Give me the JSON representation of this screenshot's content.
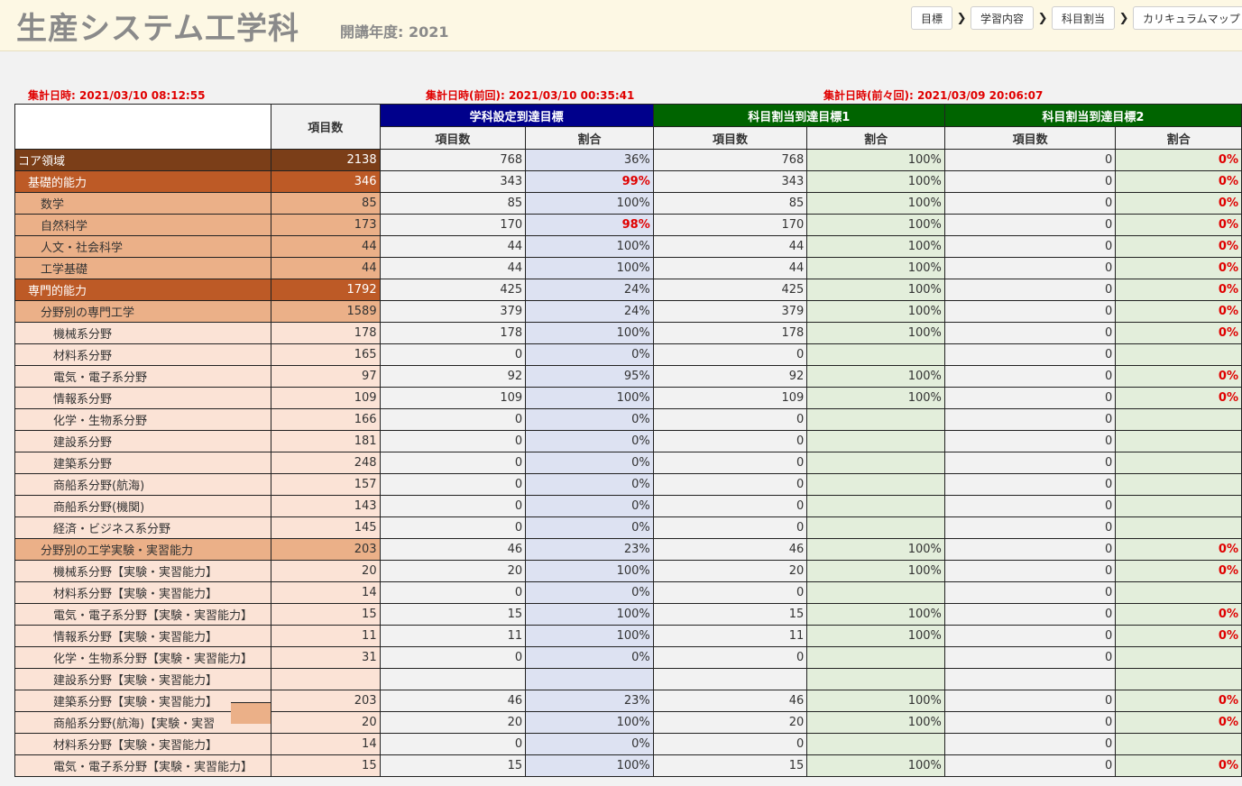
{
  "header": {
    "title": "生産システム工学科",
    "year_label": "開講年度: 2021",
    "nav": [
      {
        "label": "目標"
      },
      {
        "label": "学習内容"
      },
      {
        "label": "科目割当"
      },
      {
        "label": "カリキュラムマップ"
      }
    ]
  },
  "timestamps": {
    "current": "集計日時: 2021/03/10 08:12:55",
    "previous": "集計日時(前回): 2021/03/10 00:35:41",
    "before_previous": "集計日時(前々回): 2021/03/09 20:06:07"
  },
  "table": {
    "header": {
      "count": "項目数",
      "group1": "学科設定到達目標",
      "group2": "科目割当到達目標1",
      "group3": "科目割当到達目標2",
      "sub_count": "項目数",
      "sub_ratio": "割合"
    },
    "rows": [
      {
        "name": "コア領域",
        "level": 0,
        "total": "2138",
        "c1": "768",
        "r1": "36%",
        "r1red": false,
        "c2": "768",
        "r2": "100%",
        "r2red": false,
        "c3": "0",
        "r3": "0%",
        "r3red": true
      },
      {
        "name": "基礎的能力",
        "level": 1,
        "total": "346",
        "c1": "343",
        "r1": "99%",
        "r1red": true,
        "c2": "343",
        "r2": "100%",
        "r2red": false,
        "c3": "0",
        "r3": "0%",
        "r3red": true
      },
      {
        "name": "数学",
        "level": 2,
        "total": "85",
        "c1": "85",
        "r1": "100%",
        "r1red": false,
        "c2": "85",
        "r2": "100%",
        "r2red": false,
        "c3": "0",
        "r3": "0%",
        "r3red": true
      },
      {
        "name": "自然科学",
        "level": 2,
        "total": "173",
        "c1": "170",
        "r1": "98%",
        "r1red": true,
        "c2": "170",
        "r2": "100%",
        "r2red": false,
        "c3": "0",
        "r3": "0%",
        "r3red": true
      },
      {
        "name": "人文・社会科学",
        "level": 2,
        "total": "44",
        "c1": "44",
        "r1": "100%",
        "r1red": false,
        "c2": "44",
        "r2": "100%",
        "r2red": false,
        "c3": "0",
        "r3": "0%",
        "r3red": true
      },
      {
        "name": "工学基礎",
        "level": 2,
        "total": "44",
        "c1": "44",
        "r1": "100%",
        "r1red": false,
        "c2": "44",
        "r2": "100%",
        "r2red": false,
        "c3": "0",
        "r3": "0%",
        "r3red": true
      },
      {
        "name": "専門的能力",
        "level": 1,
        "total": "1792",
        "c1": "425",
        "r1": "24%",
        "r1red": false,
        "c2": "425",
        "r2": "100%",
        "r2red": false,
        "c3": "0",
        "r3": "0%",
        "r3red": true
      },
      {
        "name": "分野別の専門工学",
        "level": 2,
        "total": "1589",
        "c1": "379",
        "r1": "24%",
        "r1red": false,
        "c2": "379",
        "r2": "100%",
        "r2red": false,
        "c3": "0",
        "r3": "0%",
        "r3red": true
      },
      {
        "name": "機械系分野",
        "level": 3,
        "total": "178",
        "c1": "178",
        "r1": "100%",
        "r1red": false,
        "c2": "178",
        "r2": "100%",
        "r2red": false,
        "c3": "0",
        "r3": "0%",
        "r3red": true
      },
      {
        "name": "材料系分野",
        "level": 3,
        "total": "165",
        "c1": "0",
        "r1": "0%",
        "r1red": false,
        "c2": "0",
        "r2": "",
        "r2red": false,
        "c3": "0",
        "r3": "",
        "r3red": false
      },
      {
        "name": "電気・電子系分野",
        "level": 3,
        "total": "97",
        "c1": "92",
        "r1": "95%",
        "r1red": false,
        "c2": "92",
        "r2": "100%",
        "r2red": false,
        "c3": "0",
        "r3": "0%",
        "r3red": true
      },
      {
        "name": "情報系分野",
        "level": 3,
        "total": "109",
        "c1": "109",
        "r1": "100%",
        "r1red": false,
        "c2": "109",
        "r2": "100%",
        "r2red": false,
        "c3": "0",
        "r3": "0%",
        "r3red": true
      },
      {
        "name": "化学・生物系分野",
        "level": 3,
        "total": "166",
        "c1": "0",
        "r1": "0%",
        "r1red": false,
        "c2": "0",
        "r2": "",
        "r2red": false,
        "c3": "0",
        "r3": "",
        "r3red": false
      },
      {
        "name": "建設系分野",
        "level": 3,
        "total": "181",
        "c1": "0",
        "r1": "0%",
        "r1red": false,
        "c2": "0",
        "r2": "",
        "r2red": false,
        "c3": "0",
        "r3": "",
        "r3red": false
      },
      {
        "name": "建築系分野",
        "level": 3,
        "total": "248",
        "c1": "0",
        "r1": "0%",
        "r1red": false,
        "c2": "0",
        "r2": "",
        "r2red": false,
        "c3": "0",
        "r3": "",
        "r3red": false
      },
      {
        "name": "商船系分野(航海)",
        "level": 3,
        "total": "157",
        "c1": "0",
        "r1": "0%",
        "r1red": false,
        "c2": "0",
        "r2": "",
        "r2red": false,
        "c3": "0",
        "r3": "",
        "r3red": false
      },
      {
        "name": "商船系分野(機関)",
        "level": 3,
        "total": "143",
        "c1": "0",
        "r1": "0%",
        "r1red": false,
        "c2": "0",
        "r2": "",
        "r2red": false,
        "c3": "0",
        "r3": "",
        "r3red": false
      },
      {
        "name": "経済・ビジネス系分野",
        "level": 3,
        "total": "145",
        "c1": "0",
        "r1": "0%",
        "r1red": false,
        "c2": "0",
        "r2": "",
        "r2red": false,
        "c3": "0",
        "r3": "",
        "r3red": false
      },
      {
        "name": "分野別の工学実験・実習能力",
        "level": 2,
        "total": "203",
        "c1": "46",
        "r1": "23%",
        "r1red": false,
        "c2": "46",
        "r2": "100%",
        "r2red": false,
        "c3": "0",
        "r3": "0%",
        "r3red": true
      },
      {
        "name": "機械系分野【実験・実習能力】",
        "level": 3,
        "total": "20",
        "c1": "20",
        "r1": "100%",
        "r1red": false,
        "c2": "20",
        "r2": "100%",
        "r2red": false,
        "c3": "0",
        "r3": "0%",
        "r3red": true
      },
      {
        "name": "材料系分野【実験・実習能力】",
        "level": 3,
        "total": "14",
        "c1": "0",
        "r1": "0%",
        "r1red": false,
        "c2": "0",
        "r2": "",
        "r2red": false,
        "c3": "0",
        "r3": "",
        "r3red": false
      },
      {
        "name": "電気・電子系分野【実験・実習能力】",
        "level": 3,
        "total": "15",
        "c1": "15",
        "r1": "100%",
        "r1red": false,
        "c2": "15",
        "r2": "100%",
        "r2red": false,
        "c3": "0",
        "r3": "0%",
        "r3red": true
      },
      {
        "name": "情報系分野【実験・実習能力】",
        "level": 3,
        "total": "11",
        "c1": "11",
        "r1": "100%",
        "r1red": false,
        "c2": "11",
        "r2": "100%",
        "r2red": false,
        "c3": "0",
        "r3": "0%",
        "r3red": true
      },
      {
        "name": "化学・生物系分野【実験・実習能力】",
        "level": 3,
        "total": "31",
        "c1": "0",
        "r1": "0%",
        "r1red": false,
        "c2": "0",
        "r2": "",
        "r2red": false,
        "c3": "0",
        "r3": "",
        "r3red": false
      },
      {
        "name": "建設系分野【実験・実習能力】",
        "level": 3,
        "total": "",
        "c1": "",
        "r1": "",
        "r1red": false,
        "c2": "",
        "r2": "",
        "r2red": false,
        "c3": "",
        "r3": "",
        "r3red": false
      },
      {
        "name": "建築系分野【実験・実習能力】",
        "level": 3,
        "total": "203",
        "c1": "46",
        "r1": "23%",
        "r1red": false,
        "c2": "46",
        "r2": "100%",
        "r2red": false,
        "c3": "0",
        "r3": "0%",
        "r3red": true
      },
      {
        "name": "商船系分野(航海)【実験・実習",
        "level": 3,
        "total": "20",
        "c1": "20",
        "r1": "100%",
        "r1red": false,
        "c2": "20",
        "r2": "100%",
        "r2red": false,
        "c3": "0",
        "r3": "0%",
        "r3red": true
      },
      {
        "name": "材料系分野【実験・実習能力】",
        "level": 3,
        "total": "14",
        "c1": "0",
        "r1": "0%",
        "r1red": false,
        "c2": "0",
        "r2": "",
        "r2red": false,
        "c3": "0",
        "r3": "",
        "r3red": false
      },
      {
        "name": "電気・電子系分野【実験・実習能力】",
        "level": 3,
        "total": "15",
        "c1": "15",
        "r1": "100%",
        "r1red": false,
        "c2": "15",
        "r2": "100%",
        "r2red": false,
        "c3": "0",
        "r3": "0%",
        "r3red": true
      }
    ]
  }
}
